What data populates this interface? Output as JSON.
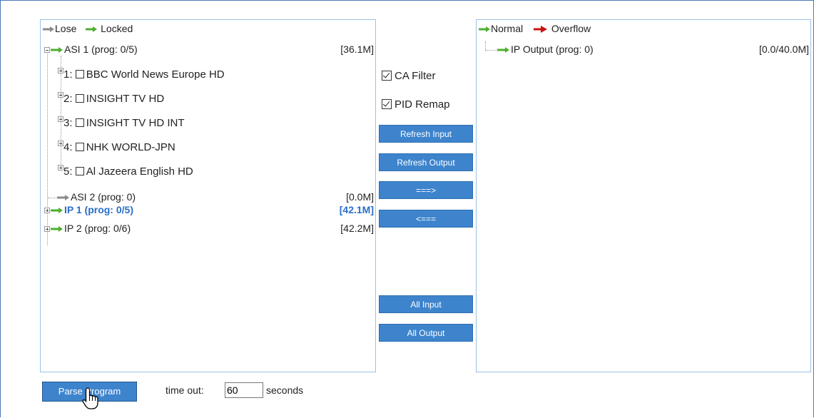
{
  "left_panel": {
    "legend": {
      "lose": "Lose",
      "locked": "Locked"
    },
    "tree": {
      "asi1": {
        "label": "ASI 1 (prog: 0/5)",
        "size": "[36.1M]"
      },
      "programs": [
        {
          "num": "1:",
          "name": "BBC World News Europe HD"
        },
        {
          "num": "2:",
          "name": "INSIGHT TV HD"
        },
        {
          "num": "3:",
          "name": "INSIGHT TV HD INT"
        },
        {
          "num": "4:",
          "name": "NHK WORLD-JPN"
        },
        {
          "num": "5:",
          "name": "Al Jazeera English HD"
        }
      ],
      "asi2": {
        "label": "ASI 2 (prog: 0)",
        "size": "[0.0M]"
      },
      "ip1": {
        "label": "IP 1 (prog: 0/5)",
        "size": "[42.1M]"
      },
      "ip2": {
        "label": "IP 2 (prog: 0/6)",
        "size": "[42.2M]"
      }
    }
  },
  "middle": {
    "ca_filter": "CA Filter",
    "pid_remap": "PID Remap",
    "buttons": {
      "refresh_input": "Refresh Input",
      "refresh_output": "Refresh Output",
      "move_right": "===>",
      "move_left": "<===",
      "all_input": "All Input",
      "all_output": "All Output"
    }
  },
  "right_panel": {
    "legend": {
      "normal": "Normal",
      "overflow": "Overflow"
    },
    "output": {
      "label": "IP Output (prog: 0)",
      "size": "[0.0/40.0M]"
    }
  },
  "bottom": {
    "parse_button": "Parse Program",
    "timeout_label": "time out:",
    "timeout_value": "60",
    "seconds_label": "seconds"
  },
  "colors": {
    "arrow_gray": "#8a8a8a",
    "arrow_green": "#4caf2f",
    "arrow_red": "#cc1111",
    "button_blue": "#3d84cd",
    "selected_text": "#2a6ec8"
  }
}
